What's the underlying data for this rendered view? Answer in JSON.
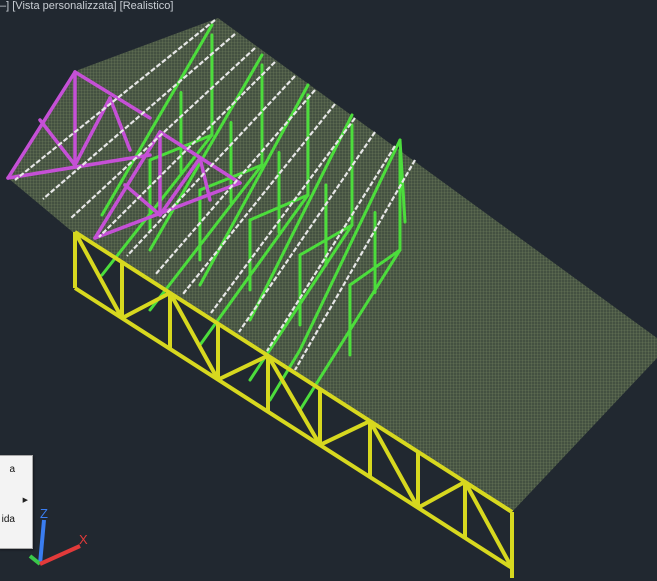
{
  "viewport": {
    "controls_prefix": "–]",
    "view_label": "[Vista personalizzata]",
    "style_label": "[Realistico]"
  },
  "context_menu": {
    "items": [
      {
        "label": "a",
        "has_submenu": false
      },
      {
        "label": "",
        "has_submenu": true
      },
      {
        "label": "ida",
        "has_submenu": false
      }
    ]
  },
  "ucs": {
    "z_label": "Z",
    "x_label": "X"
  },
  "colors": {
    "background": "#212830",
    "roof_mesh": "#5e6e4e",
    "green_trusses": "#4cdd3c",
    "magenta_trusses": "#c550d6",
    "yellow_truss": "#d7d81f",
    "purlins": "#e6e6e6",
    "ucs_z": "#3a7df0",
    "ucs_y": "#3ac84a",
    "ucs_x": "#e23a3a"
  }
}
